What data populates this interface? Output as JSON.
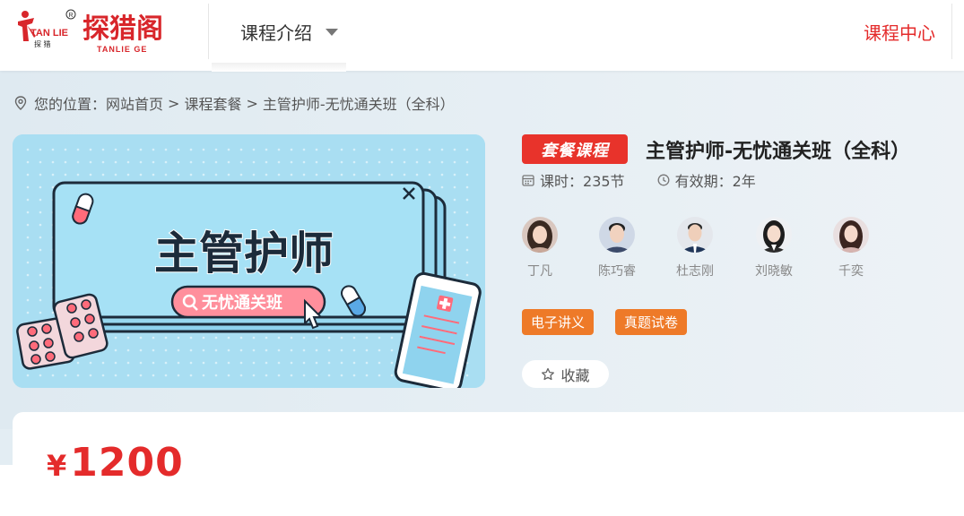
{
  "header": {
    "logo_text": "探猎阁",
    "logo_subtext": "TANLIE GE",
    "logo_mark": "TAN LIE",
    "logo_mark_small": "探 猎",
    "nav_course_label": "课程介绍",
    "course_center_label": "课程中心"
  },
  "breadcrumb": {
    "prefix": "您的位置：",
    "items": [
      "网站首页",
      "课程套餐",
      "主管护师-无忧通关班（全科）"
    ],
    "separator": ">"
  },
  "cover": {
    "headline": "主管护师",
    "search_text": "无忧通关班"
  },
  "course": {
    "tag": "套餐课程",
    "title": "主管护师-无忧通关班（全科）",
    "hours_label": "课时：",
    "hours_value": "235节",
    "validity_label": "有效期：",
    "validity_value": "2年"
  },
  "teachers": [
    {
      "name": "丁凡"
    },
    {
      "name": "陈巧睿"
    },
    {
      "name": "杜志刚"
    },
    {
      "name": "刘晓敏"
    },
    {
      "name": "千奕"
    }
  ],
  "materials": [
    "电子讲义",
    "真题试卷"
  ],
  "favorite_label": "收藏",
  "price": {
    "currency": "¥",
    "amount": "1200"
  },
  "colors": {
    "brand_red": "#e42b2b",
    "tag_orange": "#ee7a28",
    "hero_bg": "#e3edf3",
    "cover_bg": "#a9def2"
  }
}
